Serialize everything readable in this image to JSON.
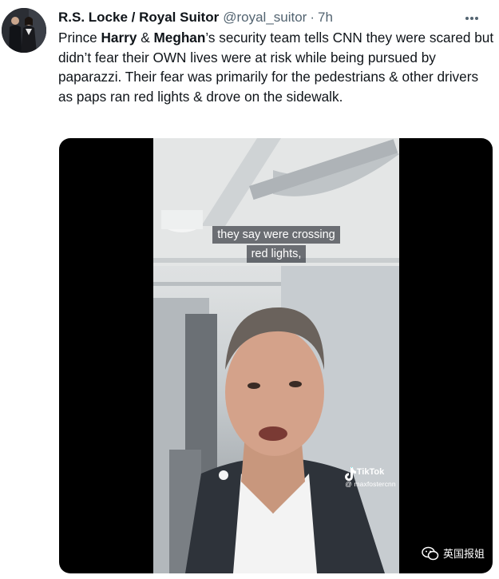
{
  "tweet": {
    "author": {
      "display_name": "R.S. Locke / Royal Suitor",
      "handle": "@royal_suitor",
      "separator": "·",
      "time": "7h"
    },
    "text_segments": [
      "Prince ",
      "Harry",
      " & ",
      "Meghan",
      "’s security team tells CNN they were scared but didn’t fear their OWN lives were at risk while being pursued by paparazzi. Their fear was primarily for the pedestrians & other drivers as paps ran red lights & drove on the sidewalk."
    ],
    "icons": {
      "more": "more-horizontal-icon",
      "tiktok": "tiktok-logo-icon",
      "wechat": "wechat-icon"
    }
  },
  "media": {
    "caption_lines": [
      "they say were crossing",
      "red lights,"
    ],
    "tiktok_label": "TikTok",
    "tiktok_user": "@ maxfostercnn",
    "watermark": "英国报姐"
  }
}
